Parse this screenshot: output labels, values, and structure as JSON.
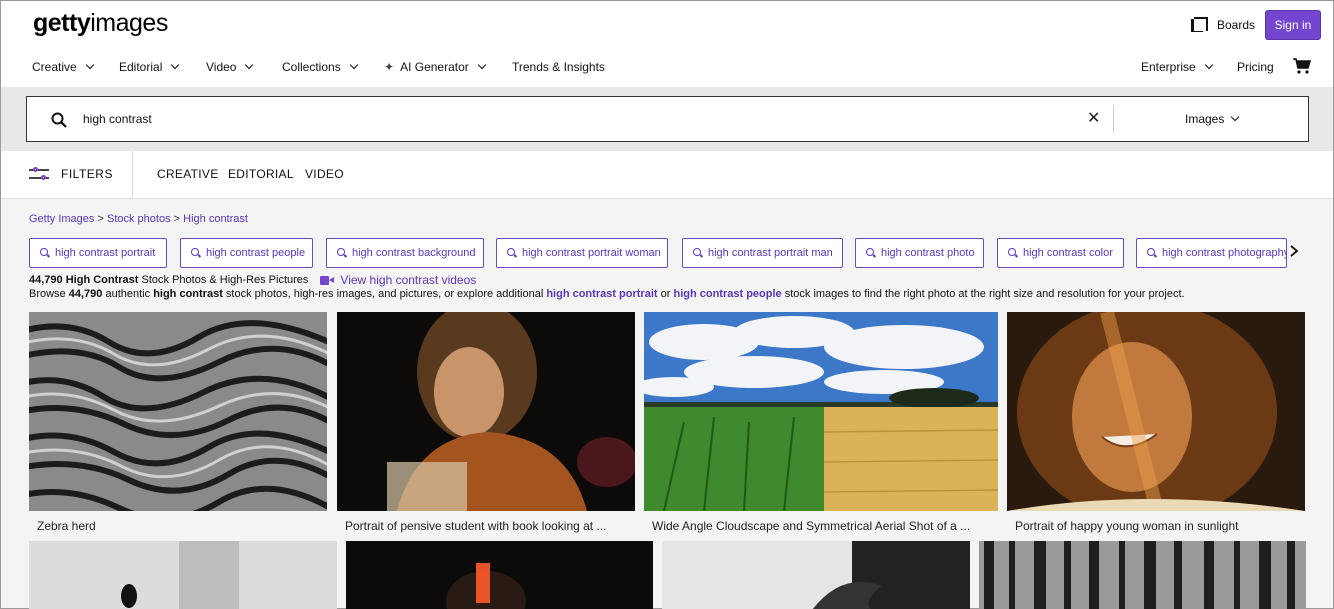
{
  "header": {
    "logo_bold": "getty",
    "logo_light": "images",
    "boards_label": "Boards",
    "signin_label": "Sign in",
    "nav": [
      "Creative",
      "Editorial",
      "Video",
      "Collections",
      "AI Generator",
      "Trends & Insights"
    ],
    "enterprise_label": "Enterprise",
    "pricing_label": "Pricing"
  },
  "search": {
    "query": "high contrast",
    "type_label": "Images"
  },
  "filters": {
    "filters_label": "FILTERS",
    "tabs": [
      "CREATIVE",
      "EDITORIAL",
      "VIDEO"
    ]
  },
  "breadcrumb": {
    "items": [
      "Getty Images",
      "Stock photos",
      "High contrast"
    ],
    "separator": ">"
  },
  "chips": [
    "high contrast portrait",
    "high contrast people",
    "high contrast background",
    "high contrast portrait woman",
    "high contrast portrait man",
    "high contrast photo",
    "high contrast color",
    "high contrast photography"
  ],
  "results": {
    "count": "44,790",
    "heading_bold": "High Contrast",
    "heading_rest": "Stock Photos & High-Res Pictures",
    "video_link": "View high contrast videos",
    "browse_prefix": "Browse",
    "browse_count": "44,790",
    "browse_mid1": "authentic",
    "browse_term": "high contrast",
    "browse_mid2": "stock photos, high-res images, and pictures, or explore additional",
    "browse_link1": "high contrast portrait",
    "browse_or": "or",
    "browse_link2": "high contrast people",
    "browse_suffix": "stock images to find the right photo at the right size and resolution for your project."
  },
  "images": [
    {
      "caption": "Zebra herd"
    },
    {
      "caption": "Portrait of pensive student with book looking at ..."
    },
    {
      "caption": "Wide Angle Cloudscape and Symmetrical Aerial Shot of a ..."
    },
    {
      "caption": "Portrait of happy young woman in sunlight"
    }
  ],
  "colors": {
    "accent": "#7445ce",
    "link": "#5a37b5"
  }
}
